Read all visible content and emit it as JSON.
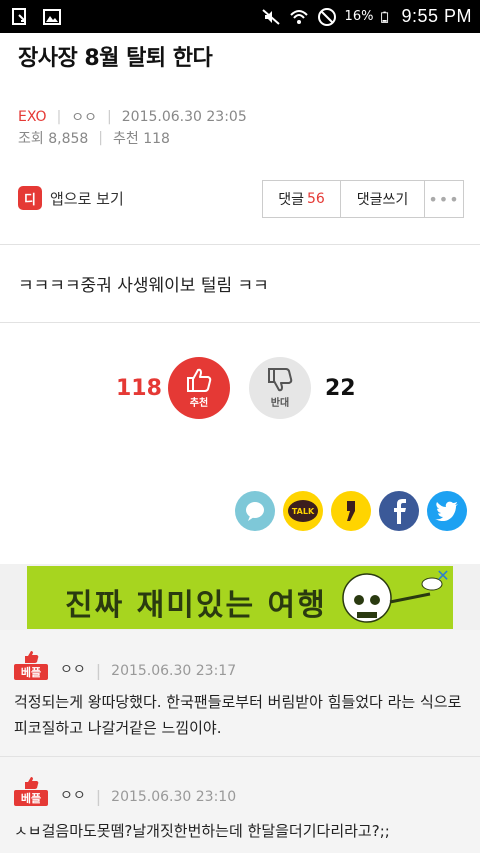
{
  "status_bar": {
    "battery": "16%",
    "time": "9:55 PM",
    "icons": [
      "download-icon",
      "image-icon",
      "mute-icon",
      "wifi-icon",
      "blocked-icon",
      "battery-icon"
    ]
  },
  "article": {
    "title": "장사장 8월 탈퇴 한다",
    "board": "EXO",
    "author": "ㅇㅇ",
    "date": "2015.06.30 23:05",
    "views": "조회 8,858",
    "recommends": "추천 118",
    "body": "ㅋㅋㅋㅋ중궈 사생웨이보 털림 ㅋㅋ"
  },
  "toolbar": {
    "app_view_label": "앱으로 보기",
    "app_icon_label": "디",
    "comments_label": "댓글",
    "comments_count": "56",
    "write_comment_label": "댓글쓰기",
    "more_label": "•••"
  },
  "votes": {
    "up_count": "118",
    "up_label": "추천",
    "down_count": "22",
    "down_label": "반대"
  },
  "share": {
    "icons": [
      "chat-bubble-icon",
      "kakaotalk-icon",
      "kakaostory-icon",
      "facebook-icon",
      "twitter-icon"
    ],
    "kakao_talk_text": "TALK"
  },
  "ad": {
    "text": "진짜 재미있는 여행",
    "close": "✕"
  },
  "comments": [
    {
      "badge": "베플",
      "author": "ㅇㅇ",
      "date": "2015.06.30 23:17",
      "body": "걱정되는게 왕따당했다. 한국팬들로부터 버림받아 힘들었다 라는 식으로 피코질하고 나갈거같은 느낌이야."
    },
    {
      "badge": "베플",
      "author": "ㅇㅇ",
      "date": "2015.06.30 23:10",
      "body": "ㅅㅂ걸음마도못뗌?날개짓한번하는데 한달을더기다리라고?;;"
    }
  ],
  "colors": {
    "accent": "#e53935",
    "ad_green": "#a7d51f",
    "facebook": "#3b5998",
    "twitter": "#1da1f2",
    "kakao": "#ffd400",
    "chat": "#7ec8d8"
  }
}
